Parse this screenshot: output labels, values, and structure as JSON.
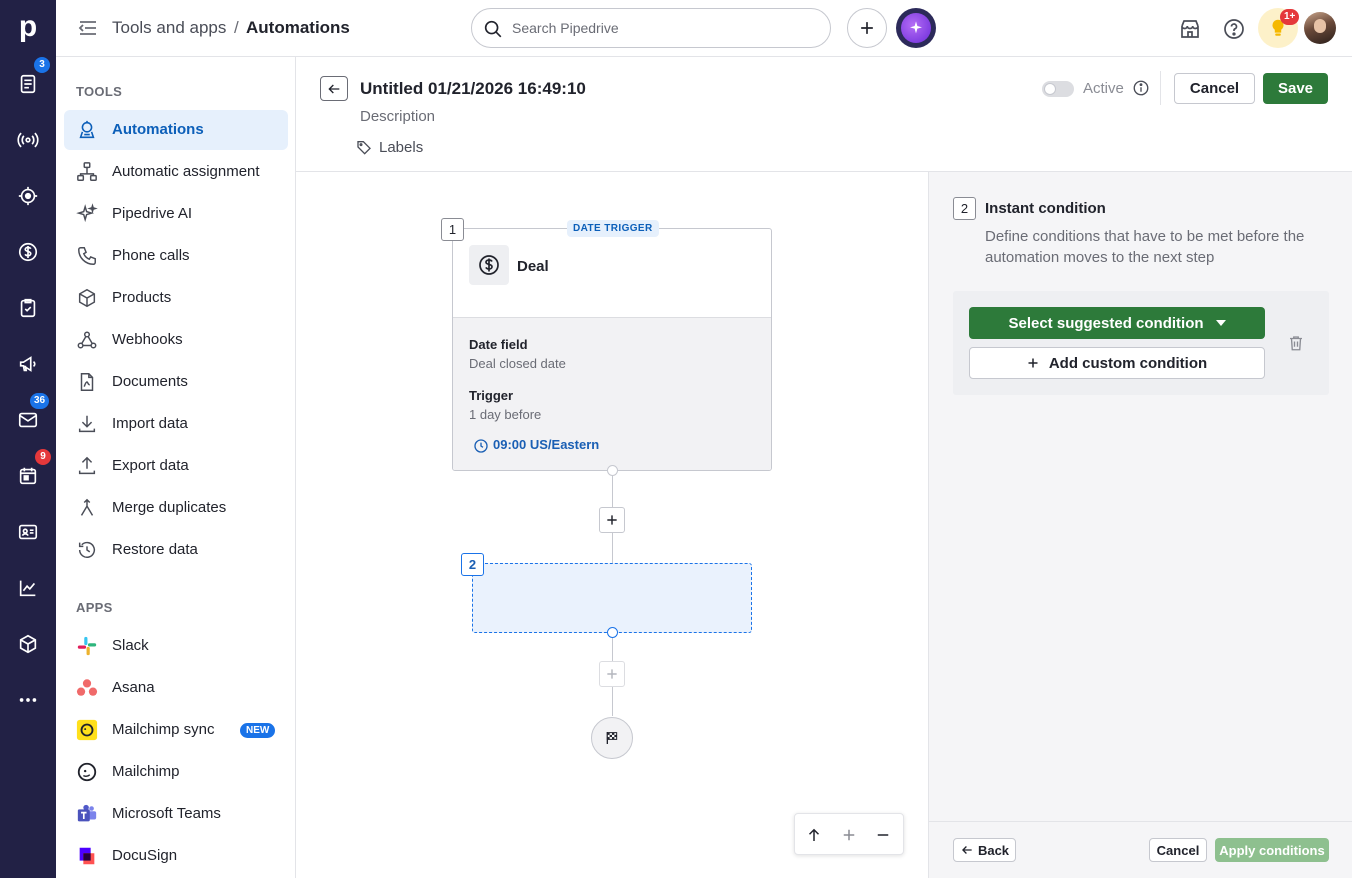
{
  "rail": {
    "logo": "p",
    "badges": {
      "activities": "3",
      "mail": "36",
      "calendar": "9"
    }
  },
  "topbar": {
    "breadcrumb_parent": "Tools and apps",
    "breadcrumb_separator": "/",
    "breadcrumb_current": "Automations",
    "search_placeholder": "Search Pipedrive",
    "notification_badge": "1+"
  },
  "sidebar": {
    "tools_heading": "TOOLS",
    "tools": [
      {
        "label": "Automations"
      },
      {
        "label": "Automatic assignment"
      },
      {
        "label": "Pipedrive AI"
      },
      {
        "label": "Phone calls"
      },
      {
        "label": "Products"
      },
      {
        "label": "Webhooks"
      },
      {
        "label": "Documents"
      },
      {
        "label": "Import data"
      },
      {
        "label": "Export data"
      },
      {
        "label": "Merge duplicates"
      },
      {
        "label": "Restore data"
      }
    ],
    "apps_heading": "APPS",
    "apps": [
      {
        "label": "Slack"
      },
      {
        "label": "Asana"
      },
      {
        "label": "Mailchimp sync",
        "badge": "NEW"
      },
      {
        "label": "Mailchimp"
      },
      {
        "label": "Microsoft Teams"
      },
      {
        "label": "DocuSign"
      }
    ]
  },
  "header": {
    "title": "Untitled 01/21/2026 16:49:10",
    "description": "Description",
    "labels": "Labels",
    "active_label": "Active",
    "active": false,
    "cancel": "Cancel",
    "save": "Save"
  },
  "flow": {
    "step1_number": "1",
    "trigger_tag": "DATE TRIGGER",
    "trigger_entity": "Deal",
    "date_field_label": "Date field",
    "date_field_value": "Deal closed date",
    "trigger_label": "Trigger",
    "trigger_value": "1 day before",
    "time_value": "09:00 US/Eastern",
    "step2_number": "2"
  },
  "panel": {
    "step_number": "2",
    "title": "Instant condition",
    "description": "Define conditions that have to be met before the automation moves to the next step",
    "suggested": "Select suggested condition",
    "custom": "Add custom condition",
    "back": "Back",
    "cancel": "Cancel",
    "apply": "Apply conditions"
  },
  "colors": {
    "rail": "#222145",
    "primary_green": "#2d7a3a",
    "accent_blue": "#1a73e8",
    "active_bg": "#e6f0fc",
    "placeholder_bg": "#eaf2fd"
  }
}
